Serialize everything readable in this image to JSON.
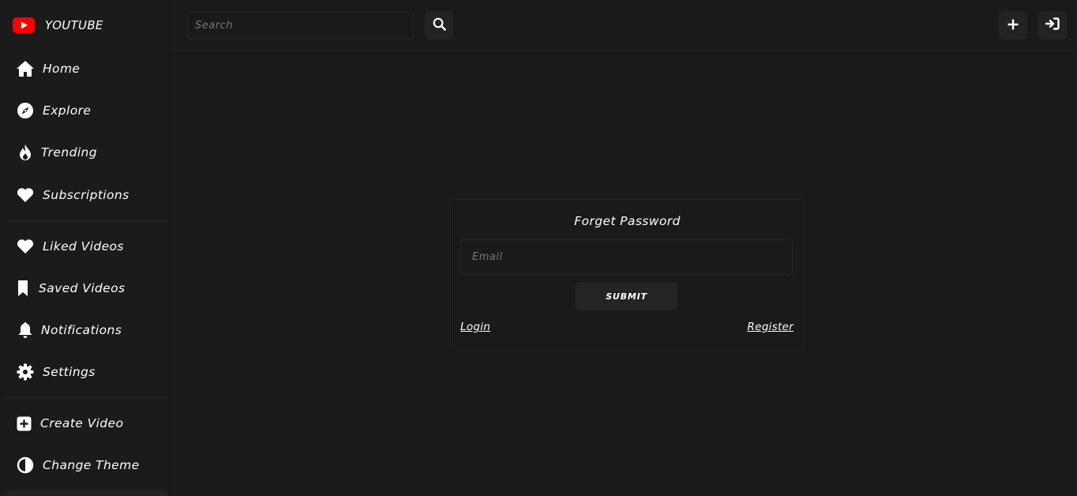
{
  "brand": {
    "name": "YOUTUBE",
    "logo_color": "#ff0000"
  },
  "sidebar": {
    "items": [
      {
        "label": "Home",
        "icon": "home-icon"
      },
      {
        "label": "Explore",
        "icon": "compass-icon"
      },
      {
        "label": "Trending",
        "icon": "fire-icon"
      },
      {
        "label": "Subscriptions",
        "icon": "heart-icon"
      },
      {
        "label": "Liked Videos",
        "icon": "heart-icon"
      },
      {
        "label": "Saved Videos",
        "icon": "bookmark-icon"
      },
      {
        "label": "Notifications",
        "icon": "bell-icon"
      },
      {
        "label": "Settings",
        "icon": "gear-icon"
      },
      {
        "label": "Create Video",
        "icon": "plus-square-icon"
      },
      {
        "label": "Change Theme",
        "icon": "half-circle-icon"
      }
    ]
  },
  "topbar": {
    "search": {
      "placeholder": "Search",
      "icon": "search-icon"
    },
    "actions": [
      {
        "icon": "plus-icon"
      },
      {
        "icon": "sign-in-icon"
      }
    ]
  },
  "forget_password": {
    "title": "Forget Password",
    "email_placeholder": "Email",
    "submit_label": "SUBMIT",
    "login_link": "Login",
    "register_link": "Register"
  },
  "colors": {
    "background": "#1a1a1a",
    "panel": "#232323",
    "text": "#ffffff",
    "placeholder": "#777777"
  }
}
